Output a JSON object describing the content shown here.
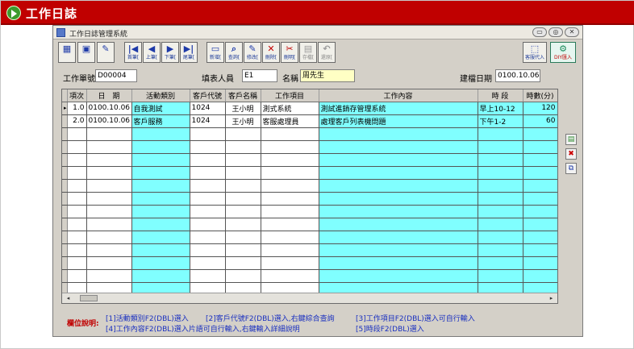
{
  "page": {
    "title": "工作日誌"
  },
  "window": {
    "title": "工作日誌管理系統",
    "controls": [
      "▭",
      "◎",
      "✕"
    ]
  },
  "toolbar": {
    "left_icons": [
      "calendar-grid-icon",
      "calendar-icon",
      "tools-icon"
    ],
    "nav": [
      {
        "glyph": "|◀",
        "label": "首筆["
      },
      {
        "glyph": "◀",
        "label": "上筆["
      },
      {
        "glyph": "▶",
        "label": "下筆["
      },
      {
        "glyph": "▶|",
        "label": "尾筆["
      }
    ],
    "actions": [
      {
        "glyph": "▭",
        "label": "新增["
      },
      {
        "glyph": "⌕",
        "label": "查詢["
      },
      {
        "glyph": "✎",
        "label": "修改["
      },
      {
        "glyph": "✕",
        "label": "刪除["
      },
      {
        "glyph": "✂",
        "label": "刪明["
      },
      {
        "glyph": "▤",
        "label": "存檔["
      },
      {
        "glyph": "↶",
        "label": "還原["
      }
    ],
    "right": [
      {
        "glyph": "⬚",
        "label": "客服代入"
      },
      {
        "glyph": "⚙",
        "label": "DIY匯入"
      }
    ]
  },
  "header": {
    "sheet_no_label": "工作單號",
    "sheet_no_value": "D00004",
    "filler_label": "填表人員",
    "filler_value": "E1",
    "name_label": "名稱",
    "name_value": "周先生",
    "created_label": "建檔日期",
    "created_value": "0100.10.06"
  },
  "grid": {
    "columns": [
      "項次",
      "日　期",
      "活動類別",
      "客戶代號",
      "客戶名稱",
      "工作項目",
      "工作內容",
      "時 段",
      "時數(分)"
    ],
    "rows": [
      {
        "marker": "▸",
        "no": "1.0",
        "date": "0100.10.06",
        "activity": "自我測試",
        "cust_code": "1024",
        "cust_name": "王小明",
        "item": "測式系統",
        "content": "測試進銷存管理系統",
        "period": "早上10-12",
        "minutes": "120"
      },
      {
        "marker": "",
        "no": "2.0",
        "date": "0100.10.06",
        "activity": "客戶服務",
        "cust_code": "1024",
        "cust_name": "王小明",
        "item": "客服處理員",
        "content": "處理客戶列表機問題",
        "period": "下午1-2",
        "minutes": "60"
      }
    ],
    "empty_rows": 13,
    "scroll_left": "◂",
    "scroll_right": "▸"
  },
  "side_buttons": [
    {
      "icon": "insert-row-icon",
      "glyph": "▤",
      "color": "#2e8b2e"
    },
    {
      "icon": "delete-row-icon",
      "glyph": "✖",
      "color": "#cc0000"
    },
    {
      "icon": "copy-row-icon",
      "glyph": "⧉",
      "color": "#1e3aa8"
    }
  ],
  "notes": {
    "label": "欄位說明:",
    "lines": [
      "[1]活動類別F2(DBL)選入",
      "[2]客戶代號F2(DBL)選入,右鍵綜合查詢",
      "[3]工作項目F2(DBL)選入可自行輸入",
      "[4]工作內容F2(DBL)選入片語可自行輸入,右鍵輸入詳細說明",
      "[5]時段F2(DBL)選入"
    ]
  },
  "colors": {
    "topbar": "#c00000",
    "cyan_cells": "#80ffff",
    "yellow_field": "#ffffc4",
    "note_text": "#1a30c0"
  }
}
